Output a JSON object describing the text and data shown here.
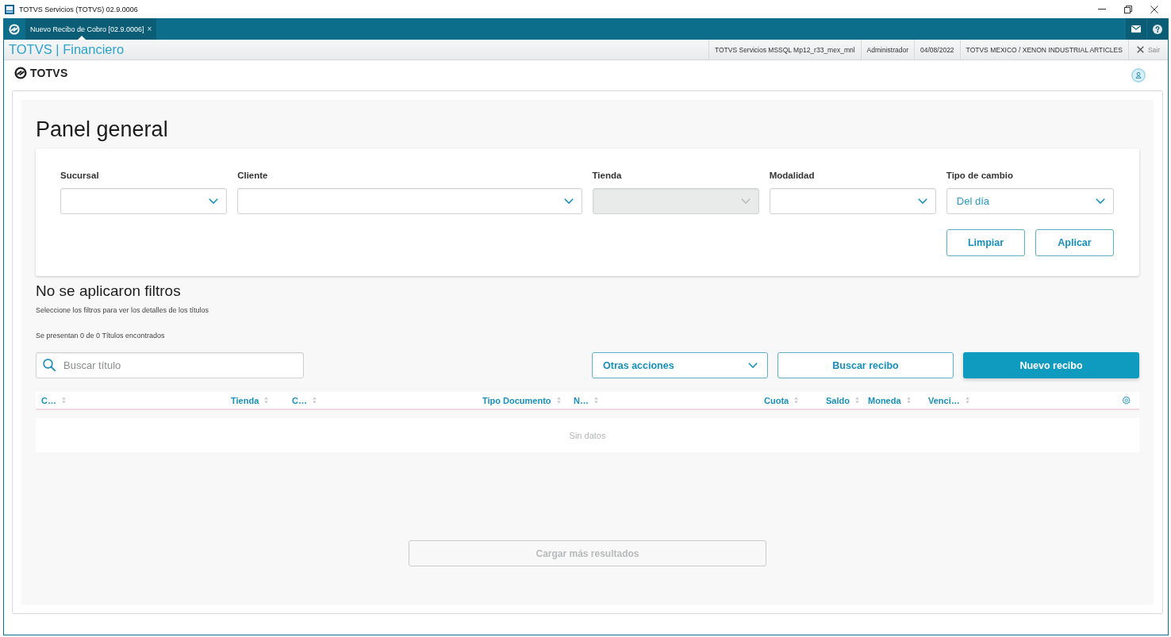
{
  "window": {
    "title": "TOTVS Servicios (TOTVS) 02.9.0006"
  },
  "tabs": [
    {
      "label": "Nuevo Recibo de Cobro [02.9.0006]",
      "close": "×",
      "selected": true
    }
  ],
  "header": {
    "title": "TOTVS | Financiero",
    "info": [
      "TOTVS Servicios MSSQL Mp12_r33_mex_mnl",
      "Administrador",
      "04/08/2022",
      "TOTVS MEXICO / XENON INDUSTRIAL ARTICLES"
    ],
    "exit": "Sair"
  },
  "logo": {
    "text": "TOTVS"
  },
  "page": {
    "title": "Panel general"
  },
  "filters": [
    {
      "label": "Sucursal",
      "disabled": false
    },
    {
      "label": "Cliente",
      "disabled": false
    },
    {
      "label": "Tienda",
      "disabled": true
    },
    {
      "label": "Modalidad",
      "disabled": false
    },
    {
      "label": "Tipo de cambio",
      "value": "Del día",
      "disabled": false
    }
  ],
  "filter_buttons": [
    "Limpiar",
    "Aplicar"
  ],
  "results": {
    "title": "No se aplicaron filtros",
    "hint": "Seleccione los filtros para ver los detalles de los títulos",
    "count": "Se presentan 0 de 0 Títulos encontrados"
  },
  "search": {
    "placeholder": "Buscar título"
  },
  "actions": [
    {
      "label": "Otras acciones",
      "kind": "dropdown"
    },
    {
      "label": "Buscar recibo",
      "kind": "secondary"
    },
    {
      "label": "Nuevo recibo",
      "kind": "primary"
    }
  ],
  "table": {
    "columns": [
      "C…",
      "Tienda",
      "C…",
      "Tipo Documento",
      "N…",
      "Cuota",
      "Saldo",
      "Moneda",
      "Venci…"
    ],
    "empty": "Sin datos"
  },
  "load_more": {
    "label": "Cargar más resultados",
    "disabled": true
  }
}
